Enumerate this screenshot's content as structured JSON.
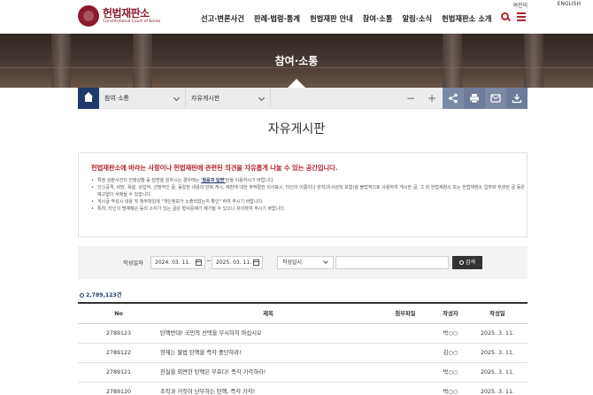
{
  "header": {
    "logo_main": "헌법재판소",
    "logo_sub": "Constitutional Court of Korea",
    "util_links": [
      "여진이",
      "ENGLISH"
    ],
    "nav": [
      "선고·변론사건",
      "판례·법령·통계",
      "헌법재판 안내",
      "참여·소통",
      "알림·소식",
      "헌법재판소 소개"
    ]
  },
  "hero": {
    "title": "참여·소통"
  },
  "location": {
    "depth1": "참여·소통",
    "depth2": "자유게시판",
    "minus": "−",
    "plus": "+"
  },
  "page": {
    "title": "자유게시판"
  },
  "notice": {
    "lead": "헌법재판소에 바라는 사항이나 헌법재판에 관련된 의견을 자유롭게 나눌 수 있는 공간입니다.",
    "items": [
      {
        "pre": "특정 심판사건의 진행상황 등 답변을 원하시는 경우에는 ",
        "link": "'질문과 답변'",
        "post": "란을 이용하시기 바랍니다."
      },
      {
        "pre": "인신공격, 비방, 욕설, 상업적, 선정적인 글, 동일한 내용의 반복 게시, 재판에 대한 부적절한 의사표시, 타인의 이름이나 관직(유사관직 포함)을 불법적으로 사용하여 게시한 글, 그 외 헌법재판소 또는 헌법재판소 업무와 무관한 글 등은 예고없이 삭제될 수 있습니다.",
        "link": "",
        "post": ""
      },
      {
        "pre": "게시글 작성시 내용 및 첨부파일에 \"개인정보가 노출되었는지 확인\" 하여 주시기 바랍니다.",
        "link": "",
        "post": ""
      },
      {
        "pre": "특히, 타인의 명예훼손 등의 소지가 있는 글은 형사문제가 제기될 수 있으니 유의하여 주시기 바랍니다.",
        "link": "",
        "post": ""
      }
    ]
  },
  "search": {
    "label": "작성일자",
    "date_from": "2024. 03. 11.",
    "date_to": "2025. 03. 11.",
    "tilde": "~",
    "field_selected": "작성일시",
    "query": "",
    "button": "검색"
  },
  "list": {
    "total": "2,789,123건",
    "columns": {
      "no": "No",
      "title": "제목",
      "file": "첨부파일",
      "writer": "작성자",
      "date": "작성일"
    },
    "rows": [
      {
        "no": "2789123",
        "title": "탄핵반대! 국민의 선택을 무시하지 마십시오",
        "writer": "박○○",
        "date": "2025. 3. 11."
      },
      {
        "no": "2789122",
        "title": "헌재는 불법 탄핵을 즉각 중단하라!",
        "writer": "김○○",
        "date": "2025. 3. 11."
      },
      {
        "no": "2789121",
        "title": "진실을 외면한 탄핵은 무효다! 즉각 기각하라!",
        "writer": "박○○",
        "date": "2025. 3. 11."
      },
      {
        "no": "2789120",
        "title": "조작과 거짓이 난무하는 탄핵, 즉각 기각!",
        "writer": "박○○",
        "date": "2025. 3. 11."
      }
    ]
  }
}
